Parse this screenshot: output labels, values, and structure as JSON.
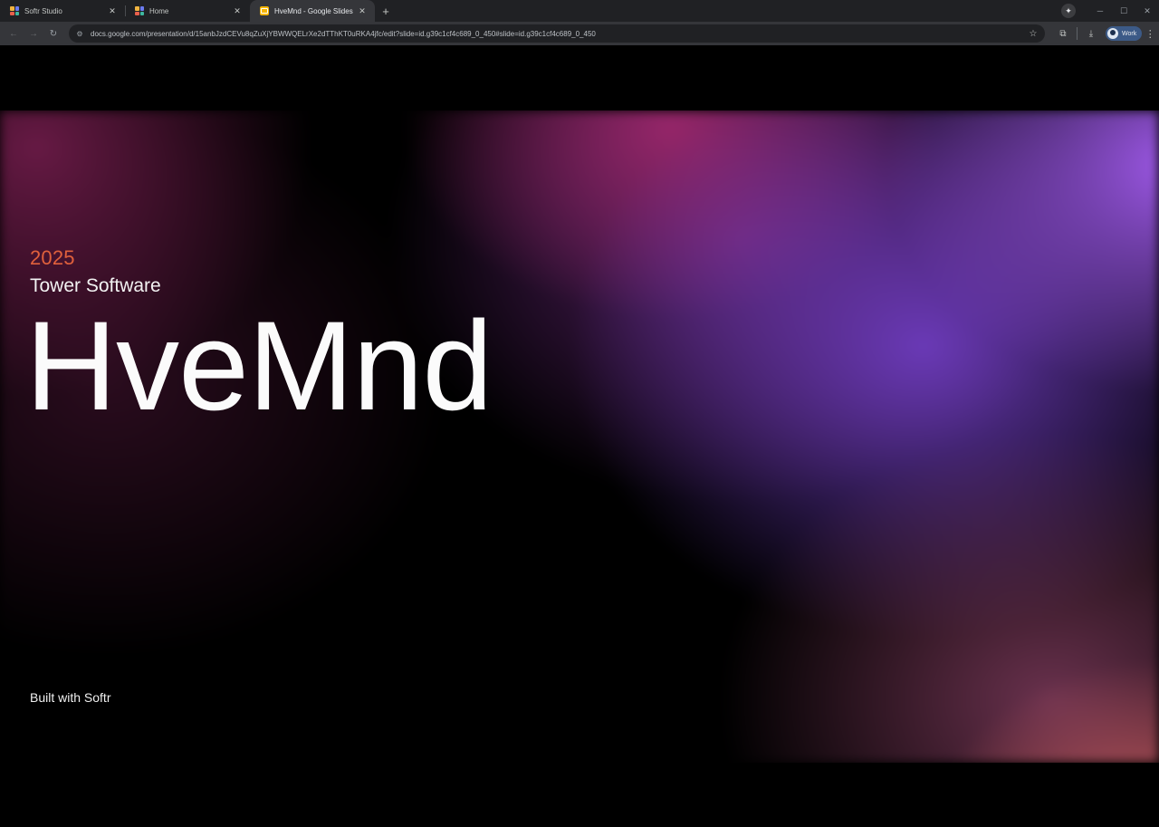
{
  "browser": {
    "tabs": [
      {
        "title": "Softr Studio",
        "favicon": "softr-logo-icon",
        "active": false
      },
      {
        "title": "Home",
        "favicon": "softr-logo-icon",
        "active": false
      },
      {
        "title": "HveMnd - Google Slides",
        "favicon": "google-slides-icon",
        "active": true
      }
    ],
    "new_tab_glyph": "+",
    "url": "docs.google.com/presentation/d/15anbJzdCEVu8qZuXjYBWWQELrXe2dTThKT0uRKA4jfc/edit?slide=id.g39c1cf4c689_0_450#slide=id.g39c1cf4c689_0_450",
    "profile_label": "Work"
  },
  "slide": {
    "year": "2025",
    "company": "Tower Software",
    "brand": "HveMnd",
    "footer": "Built with Softr"
  },
  "colors": {
    "year_accent": "#e0603c",
    "gradient_purple": "#a05aeb",
    "gradient_magenta": "#a0286e",
    "gradient_coral": "#ec6c6c"
  }
}
